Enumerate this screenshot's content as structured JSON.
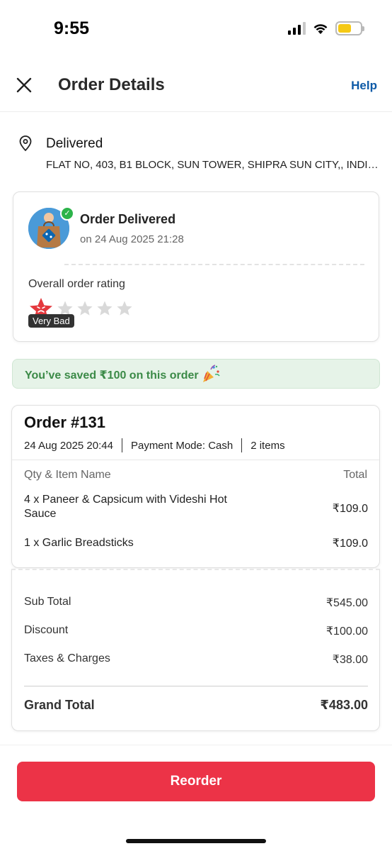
{
  "status_bar": {
    "time": "9:55"
  },
  "header": {
    "title": "Order Details",
    "help_label": "Help"
  },
  "address": {
    "status": "Delivered",
    "text": "FLAT NO, 403, B1 BLOCK, SUN TOWER, SHIPRA SUN CITY,, INDIRAPURAM"
  },
  "delivery": {
    "title": "Order Delivered",
    "date": "on 24 Aug 2025 21:28",
    "rating_label": "Overall order rating",
    "rating_value": 1,
    "rating_max": 5,
    "rating_tag": "Very Bad"
  },
  "savings": {
    "text": "You’ve saved ₹100 on this order"
  },
  "order": {
    "number": "Order #131",
    "datetime": "24 Aug 2025 20:44",
    "payment_mode": "Payment Mode: Cash",
    "item_count": "2 items",
    "col_item": "Qty & Item Name",
    "col_total": "Total",
    "items": [
      {
        "name": "4 x Paneer & Capsicum with Videshi Hot Sauce",
        "price": "₹109.0"
      },
      {
        "name": "1 x Garlic Breadsticks",
        "price": "₹109.0"
      }
    ]
  },
  "summary": {
    "sub_total_label": "Sub Total",
    "sub_total": "₹545.00",
    "discount_label": "Discount",
    "discount": "₹100.00",
    "taxes_label": "Taxes & Charges",
    "taxes": "₹38.00",
    "grand_total_label": "Grand Total",
    "grand_total": "₹483.00"
  },
  "actions": {
    "reorder_label": "Reorder"
  },
  "colors": {
    "accent": "#ec3347",
    "link": "#0d5aa7",
    "success": "#3b8a47"
  }
}
